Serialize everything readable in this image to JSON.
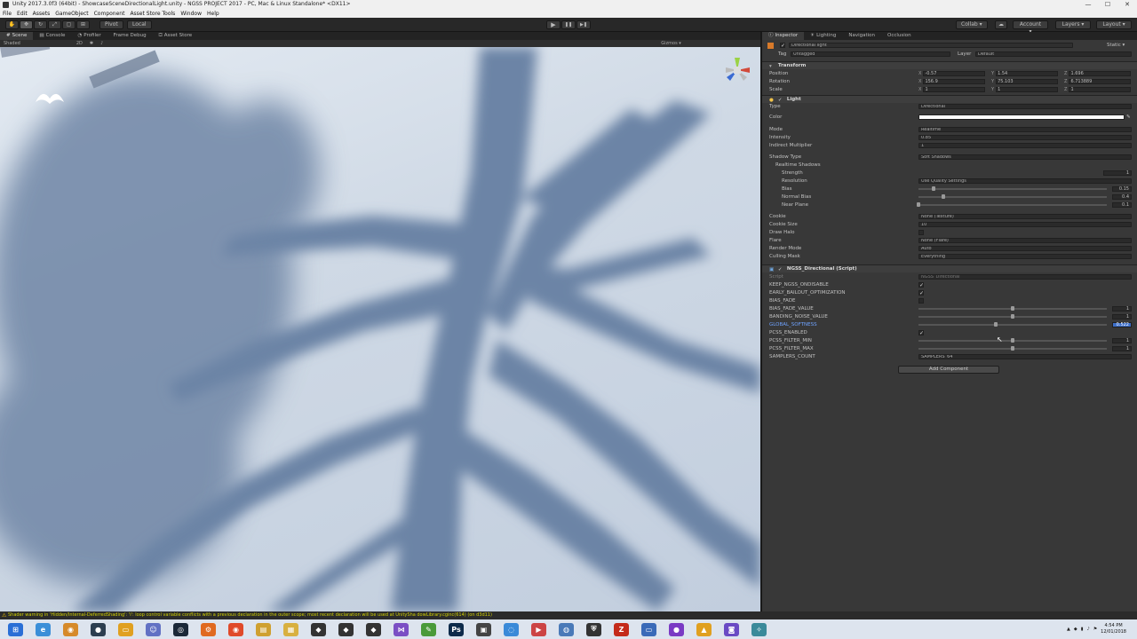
{
  "window": {
    "title": "Unity 2017.3.0f3 (64bit) - ShowcaseSceneDirectionalLight.unity - NGSS PROJECT 2017 - PC, Mac & Linux Standalone* <DX11>",
    "min": "—",
    "max": "☐",
    "close": "✕"
  },
  "menu": [
    "File",
    "Edit",
    "Assets",
    "GameObject",
    "Component",
    "Asset Store Tools",
    "Window",
    "Help"
  ],
  "toolbar": {
    "pivot": "Pivot",
    "local": "Local",
    "collab": "Collab ▾",
    "account": "Account ▾",
    "layers": "Layers ▾",
    "layout": "Layout ▾",
    "play": "▶",
    "pause": "❚❚",
    "step": "▶❚"
  },
  "left_tabs": [
    "Scene",
    "Console",
    "Profiler",
    "Frame Debug",
    "Asset Store"
  ],
  "right_tabs": [
    "Inspector",
    "Lighting",
    "Navigation",
    "Occlusion"
  ],
  "scenebar": {
    "shaded": "Shaded",
    "mode2d": "2D",
    "gizmos": "Gizmos ▾"
  },
  "inspector": {
    "object_name": "Directional light",
    "static_label": "Static ▾",
    "tag_label": "Tag",
    "tag_value": "Untagged",
    "layer_label": "Layer",
    "layer_value": "Default",
    "transform": {
      "title": "Transform",
      "position": {
        "label": "Position",
        "x": "-0.57",
        "y": "1.54",
        "z": "1.696"
      },
      "rotation": {
        "label": "Rotation",
        "x": "156.9",
        "y": "75.103",
        "z": "6.713889"
      },
      "scale": {
        "label": "Scale",
        "x": "1",
        "y": "1",
        "z": "1"
      }
    },
    "light": {
      "title": "Light",
      "type_label": "Type",
      "type_value": "Directional",
      "color_label": "Color",
      "mode_label": "Mode",
      "mode_value": "Realtime",
      "intensity_label": "Intensity",
      "intensity_value": "0.85",
      "indirect_label": "Indirect Multiplier",
      "indirect_value": "1",
      "shadow_type_label": "Shadow Type",
      "shadow_type_value": "Soft Shadows",
      "realtime_shadows": "Realtime Shadows",
      "strength_label": "Strength",
      "strength_value": "1",
      "resolution_label": "Resolution",
      "resolution_value": "Use Quality Settings",
      "bias_label": "Bias",
      "bias_value": "0.15",
      "bias_fraction": 0.08,
      "normal_bias_label": "Normal Bias",
      "normal_bias_value": "0.4",
      "normal_bias_fraction": 0.13,
      "near_plane_label": "Near Plane",
      "near_plane_value": "0.1",
      "near_plane_fraction": 0.0,
      "cookie_label": "Cookie",
      "cookie_value": "None (Texture)",
      "cookie_size_label": "Cookie Size",
      "cookie_size_value": "10",
      "draw_halo_label": "Draw Halo",
      "flare_label": "Flare",
      "flare_value": "None (Flare)",
      "render_mode_label": "Render Mode",
      "render_mode_value": "Auto",
      "culling_label": "Culling Mask",
      "culling_value": "Everything"
    },
    "script": {
      "title": "NGSS_Directional (Script)",
      "script_label": "Script",
      "script_value": "NGSS_Directional",
      "keep_label": "KEEP_NGSS_ONDISABLE",
      "early_label": "EARLY_BAILOUT_OPTIMIZATION",
      "bias_fade_label": "BIAS_FADE",
      "bias_fade_value_label": "BIAS_FADE_VALUE",
      "bias_fade_value": "1",
      "bias_fade_fraction": 0.5,
      "banding_label": "BANDING_NOISE_VALUE",
      "banding_value": "1",
      "banding_fraction": 0.5,
      "softness_label": "GLOBAL_SOFTNESS",
      "softness_value": "0.522",
      "softness_fraction": 0.41,
      "pcss_label": "PCSS_ENABLED",
      "pcss_min_label": "PCSS_FILTER_MIN",
      "pcss_min_value": "1",
      "pcss_min_fraction": 0.5,
      "pcss_max_label": "PCSS_FILTER_MAX",
      "pcss_max_value": "1",
      "pcss_max_fraction": 0.5,
      "samplers_label": "SAMPLERS_COUNT",
      "samplers_value": "SAMPLERS_64"
    },
    "add_component": "Add Component"
  },
  "status": {
    "message": "Shader warning in 'Hidden/Internal-DeferredShading': 'i': loop control variable conflicts with a previous declaration in the outer scope; most recent declaration will be used at UnitySha dowLibrary.cginc(614) (on d3d11)"
  },
  "taskbar": {
    "time": "4:54 PM",
    "date": "12/01/2018"
  },
  "colors": {
    "accent": "#4a7fd0",
    "warning": "#d4d200",
    "viewport": "#cfd9e5",
    "shadow": "#6f86a6"
  }
}
